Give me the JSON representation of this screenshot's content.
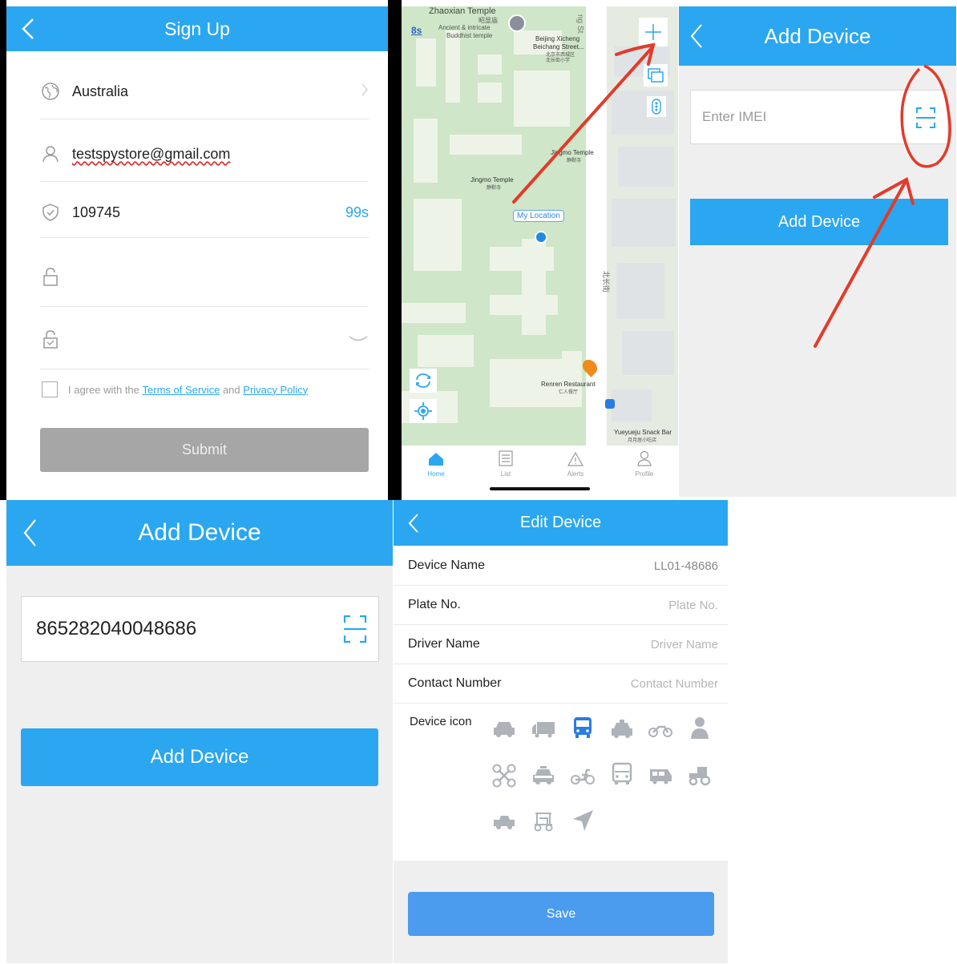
{
  "signup": {
    "title": "Sign Up",
    "country": "Australia",
    "email": "testspystore@gmail.com",
    "code": "109745",
    "countdown": "99s",
    "agree_prefix": "I agree with the",
    "terms": "Terms of Service",
    "and": "and",
    "privacy": "Privacy Policy",
    "submit": "Submit"
  },
  "map": {
    "labels": {
      "zhaoxian": "Zhaoxian Temple",
      "zhaoxian_cn": "昭显庙",
      "zhaoxian_desc1": "Ancient & intricate",
      "zhaoxian_desc2": "Buddhist temple",
      "time": "8s",
      "street_top": "ng St",
      "xicheng1": "Beijing Xicheng",
      "xicheng2": "Beichang Street...",
      "xicheng_cn1": "北京市西城区",
      "xicheng_cn2": "北长街小学",
      "jingmo_right": "Jingmo Temple",
      "jingmo_right_cn": "静默寺",
      "jingmo_left": "Jingmo Temple",
      "jingmo_left_cn": "静默寺",
      "my_location": "My Location",
      "street_cn": "北长街",
      "renren": "Renren Restaurant",
      "renren_cn": "仁人餐厅",
      "yueyueju": "Yueyueju Snack Bar",
      "yueyueju_cn": "月月居小吃店"
    },
    "tabs": [
      {
        "label": "Home",
        "active": true
      },
      {
        "label": "List",
        "active": false
      },
      {
        "label": "Alerts",
        "active": false
      },
      {
        "label": "Profile",
        "active": false
      }
    ]
  },
  "add_device_empty": {
    "title": "Add Device",
    "placeholder": "Enter IMEI",
    "button": "Add Device"
  },
  "add_device_filled": {
    "title": "Add Device",
    "imei": "865282040048686",
    "button": "Add Device"
  },
  "edit_device": {
    "title": "Edit Device",
    "fields": [
      {
        "label": "Device Name",
        "value": "LL01-48686",
        "filled": true
      },
      {
        "label": "Plate No.",
        "value": "Plate No.",
        "filled": false
      },
      {
        "label": "Driver Name",
        "value": "Driver Name",
        "filled": false
      },
      {
        "label": "Contact Number",
        "value": "Contact Number",
        "filled": false
      }
    ],
    "icon_label": "Device icon",
    "icons": [
      "car-icon",
      "truck-icon",
      "bus-icon",
      "taxi-icon",
      "motorbike-icon",
      "person-icon",
      "drone-icon",
      "police-car-icon",
      "scooter-icon",
      "van-front-icon",
      "minibus-icon",
      "tractor-icon",
      "jeep-icon",
      "cart-icon",
      "arrow-icon"
    ],
    "selected_icon": "bus-icon",
    "save": "Save"
  },
  "colors": {
    "primary": "#2aa7f0",
    "submit_disabled": "#a6a6a6",
    "annotation": "#e23b2a"
  }
}
